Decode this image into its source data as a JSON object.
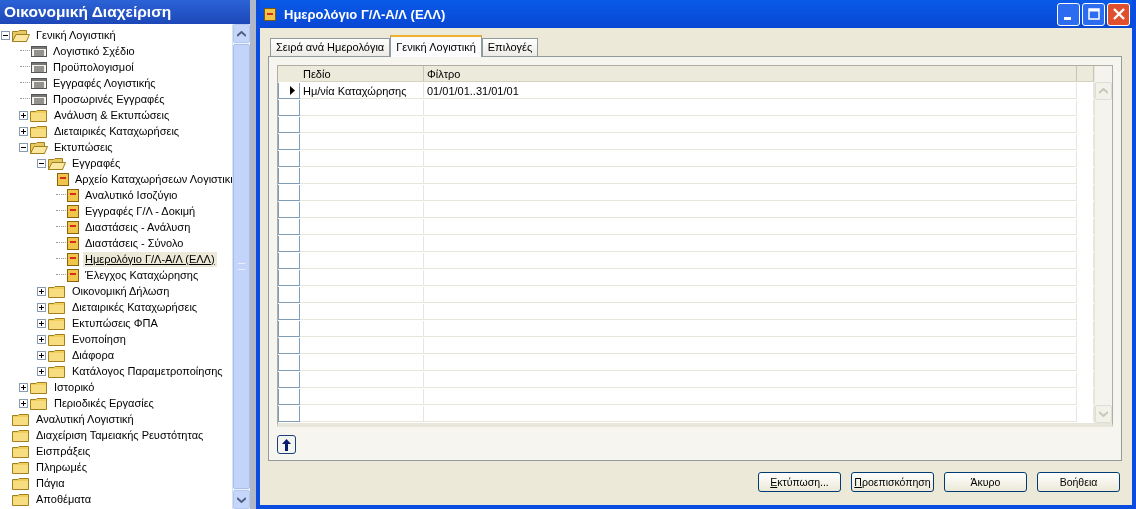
{
  "navigation_pane": {
    "title": "Οικονομική Διαχείριση",
    "tree": [
      {
        "label": "Γενική Λογιστική",
        "kind": "folder",
        "expanded": true,
        "selected": false,
        "children": [
          {
            "label": "Λογιστικό Σχέδιο",
            "kind": "list",
            "selected": false
          },
          {
            "label": "Προϋπολογισμοί",
            "kind": "list",
            "selected": false
          },
          {
            "label": "Εγγραφές Λογιστικής",
            "kind": "list",
            "selected": false
          },
          {
            "label": "Προσωρινές Εγγραφές",
            "kind": "list",
            "selected": false
          },
          {
            "label": "Ανάλυση & Εκτυπώσεις",
            "kind": "folder",
            "expanded": false,
            "selected": false
          },
          {
            "label": "Διεταιρικές Καταχωρήσεις",
            "kind": "folder",
            "expanded": false,
            "selected": false
          },
          {
            "label": "Εκτυπώσεις",
            "kind": "folder",
            "expanded": true,
            "selected": false,
            "children": [
              {
                "label": "Εγγραφές",
                "kind": "folder",
                "expanded": true,
                "selected": false,
                "children": [
                  {
                    "label": "Αρχείο Καταχωρήσεων Λογιστικι",
                    "kind": "report",
                    "selected": false
                  },
                  {
                    "label": "Αναλυτικό Ισοζύγιο",
                    "kind": "report",
                    "selected": false
                  },
                  {
                    "label": "Εγγραφές Γ/Λ - Δοκιμή",
                    "kind": "report",
                    "selected": false
                  },
                  {
                    "label": "Διαστάσεις - Ανάλυση",
                    "kind": "report",
                    "selected": false
                  },
                  {
                    "label": "Διαστάσεις - Σύνολο",
                    "kind": "report",
                    "selected": false
                  },
                  {
                    "label": "Ημερολόγιο Γ/Λ-Α/Λ (ΕΛΛ)",
                    "kind": "report",
                    "selected": true
                  },
                  {
                    "label": "Έλεγχος Καταχώρησης",
                    "kind": "report",
                    "selected": false
                  }
                ]
              },
              {
                "label": "Οικονομική Δήλωση",
                "kind": "folder",
                "expanded": false,
                "selected": false
              },
              {
                "label": "Διεταιρικές Καταχωρήσεις",
                "kind": "folder",
                "expanded": false,
                "selected": false
              },
              {
                "label": "Εκτυπώσεις ΦΠΑ",
                "kind": "folder",
                "expanded": false,
                "selected": false
              },
              {
                "label": "Ενοποίηση",
                "kind": "folder",
                "expanded": false,
                "selected": false
              },
              {
                "label": "Διάφορα",
                "kind": "folder",
                "expanded": false,
                "selected": false
              },
              {
                "label": "Κατάλογος Παραμετροποίησης",
                "kind": "folder",
                "expanded": false,
                "selected": false
              }
            ]
          },
          {
            "label": "Ιστορικό",
            "kind": "folder",
            "expanded": false,
            "selected": false
          },
          {
            "label": "Περιοδικές Εργασίες",
            "kind": "folder",
            "expanded": false,
            "selected": false
          }
        ]
      },
      {
        "label": "Αναλυτική Λογιστική",
        "kind": "folder",
        "selected": false
      },
      {
        "label": "Διαχείριση Ταμειακής Ρευστότητας",
        "kind": "folder",
        "selected": false
      },
      {
        "label": "Εισπράξεις",
        "kind": "folder",
        "selected": false
      },
      {
        "label": "Πληρωμές",
        "kind": "folder",
        "selected": false
      },
      {
        "label": "Πάγια",
        "kind": "folder",
        "selected": false
      },
      {
        "label": "Αποθέματα",
        "kind": "folder",
        "selected": false
      }
    ]
  },
  "window": {
    "title": "Ημερολόγιο Γ/Λ-Α/Λ (ΕΛΛ)",
    "tabs": [
      {
        "label": "Σειρά ανά Ημερολόγια",
        "selected": false
      },
      {
        "label": "Γενική Λογιστική",
        "selected": true
      },
      {
        "label": "Επιλογές",
        "selected": false
      }
    ],
    "table": {
      "columns": [
        "Πεδίο",
        "Φίλτρο"
      ],
      "rows": [
        {
          "cells": [
            "Ημ/νία Καταχώρησης",
            "01/01/01..31/01/01"
          ],
          "selected": true
        }
      ]
    },
    "buttons": [
      {
        "label": "Εκτύπωση...",
        "mnemonic": true
      },
      {
        "label": "Προεπισκόπηση",
        "mnemonic": true
      },
      {
        "label": "Άκυρο",
        "mnemonic": false
      },
      {
        "label": "Βοήθεια",
        "mnemonic": false
      }
    ]
  }
}
